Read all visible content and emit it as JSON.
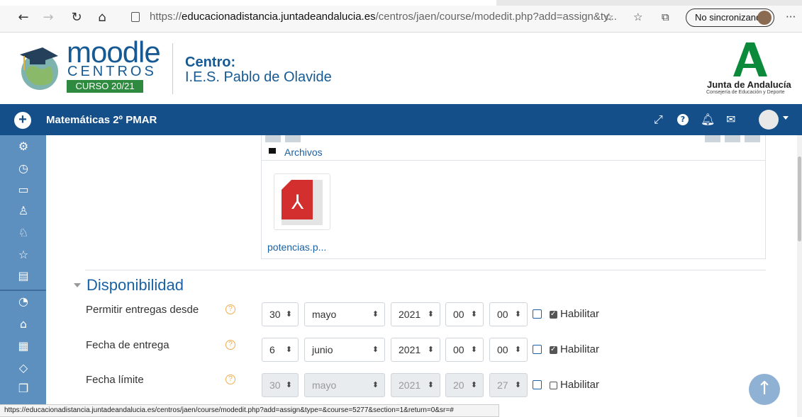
{
  "browser": {
    "url_prefix": "https://",
    "url_host": "educacionadistancia.juntadeandalucia.es",
    "url_path": "/centros/jaen/course/modedit.php?add=assign&ty...",
    "sync_label": "No sincronizando",
    "icons": [
      "back-arrow-icon",
      "forward-arrow-icon",
      "refresh-icon",
      "home-icon",
      "page-info-icon",
      "favorite-star-icon",
      "favorites-list-icon",
      "collections-icon",
      "more-icon"
    ]
  },
  "header": {
    "brand_word": "moodle",
    "brand_sub": "CENTROS",
    "curso": "CURSO 20/21",
    "centro_label": "Centro:",
    "centro_name": "I.E.S. Pablo de Olavide",
    "junta_name": "Junta de Andalucía",
    "junta_sub": "Consejería de Educación y Deporte"
  },
  "navbar": {
    "add_label": "+",
    "course_title": "Matemáticas 2º PMAR",
    "icons": [
      "expand-icon",
      "help-icon",
      "bell-icon",
      "envelope-icon",
      "user-avatar"
    ]
  },
  "drawer": {
    "icons": [
      "cogs-icon",
      "clock-icon",
      "folder-icon",
      "users-icon",
      "badge-icon",
      "star-icon",
      "book-icon",
      "dashboard-icon",
      "home-icon",
      "calendar-icon",
      "graduation-cap-icon",
      "copy-icon"
    ]
  },
  "files": {
    "folder_label": "Archivos",
    "file_name": "potencias.p..."
  },
  "section": {
    "title": "Disponibilidad"
  },
  "fields": [
    {
      "label": "Permitir entregas desde",
      "day": "30",
      "month": "mayo",
      "year": "2021",
      "hour": "00",
      "minute": "00",
      "enable_label": "Habilitar",
      "checked": true,
      "disabled": false
    },
    {
      "label": "Fecha de entrega",
      "day": "6",
      "month": "junio",
      "year": "2021",
      "hour": "00",
      "minute": "00",
      "enable_label": "Habilitar",
      "checked": true,
      "disabled": false
    },
    {
      "label": "Fecha límite",
      "day": "30",
      "month": "mayo",
      "year": "2021",
      "hour": "20",
      "minute": "27",
      "enable_label": "Habilitar",
      "checked": false,
      "disabled": true
    }
  ],
  "status_bar": "https://educacionadistancia.juntadeandalucia.es/centros/jaen/course/modedit.php?add=assign&type=&course=5277&section=1&return=0&sr=#",
  "colors": {
    "navbar": "#144f8a",
    "drawer": "#5d8fbf",
    "link": "#1a61a5",
    "curso_bg": "#2d8a3e"
  }
}
